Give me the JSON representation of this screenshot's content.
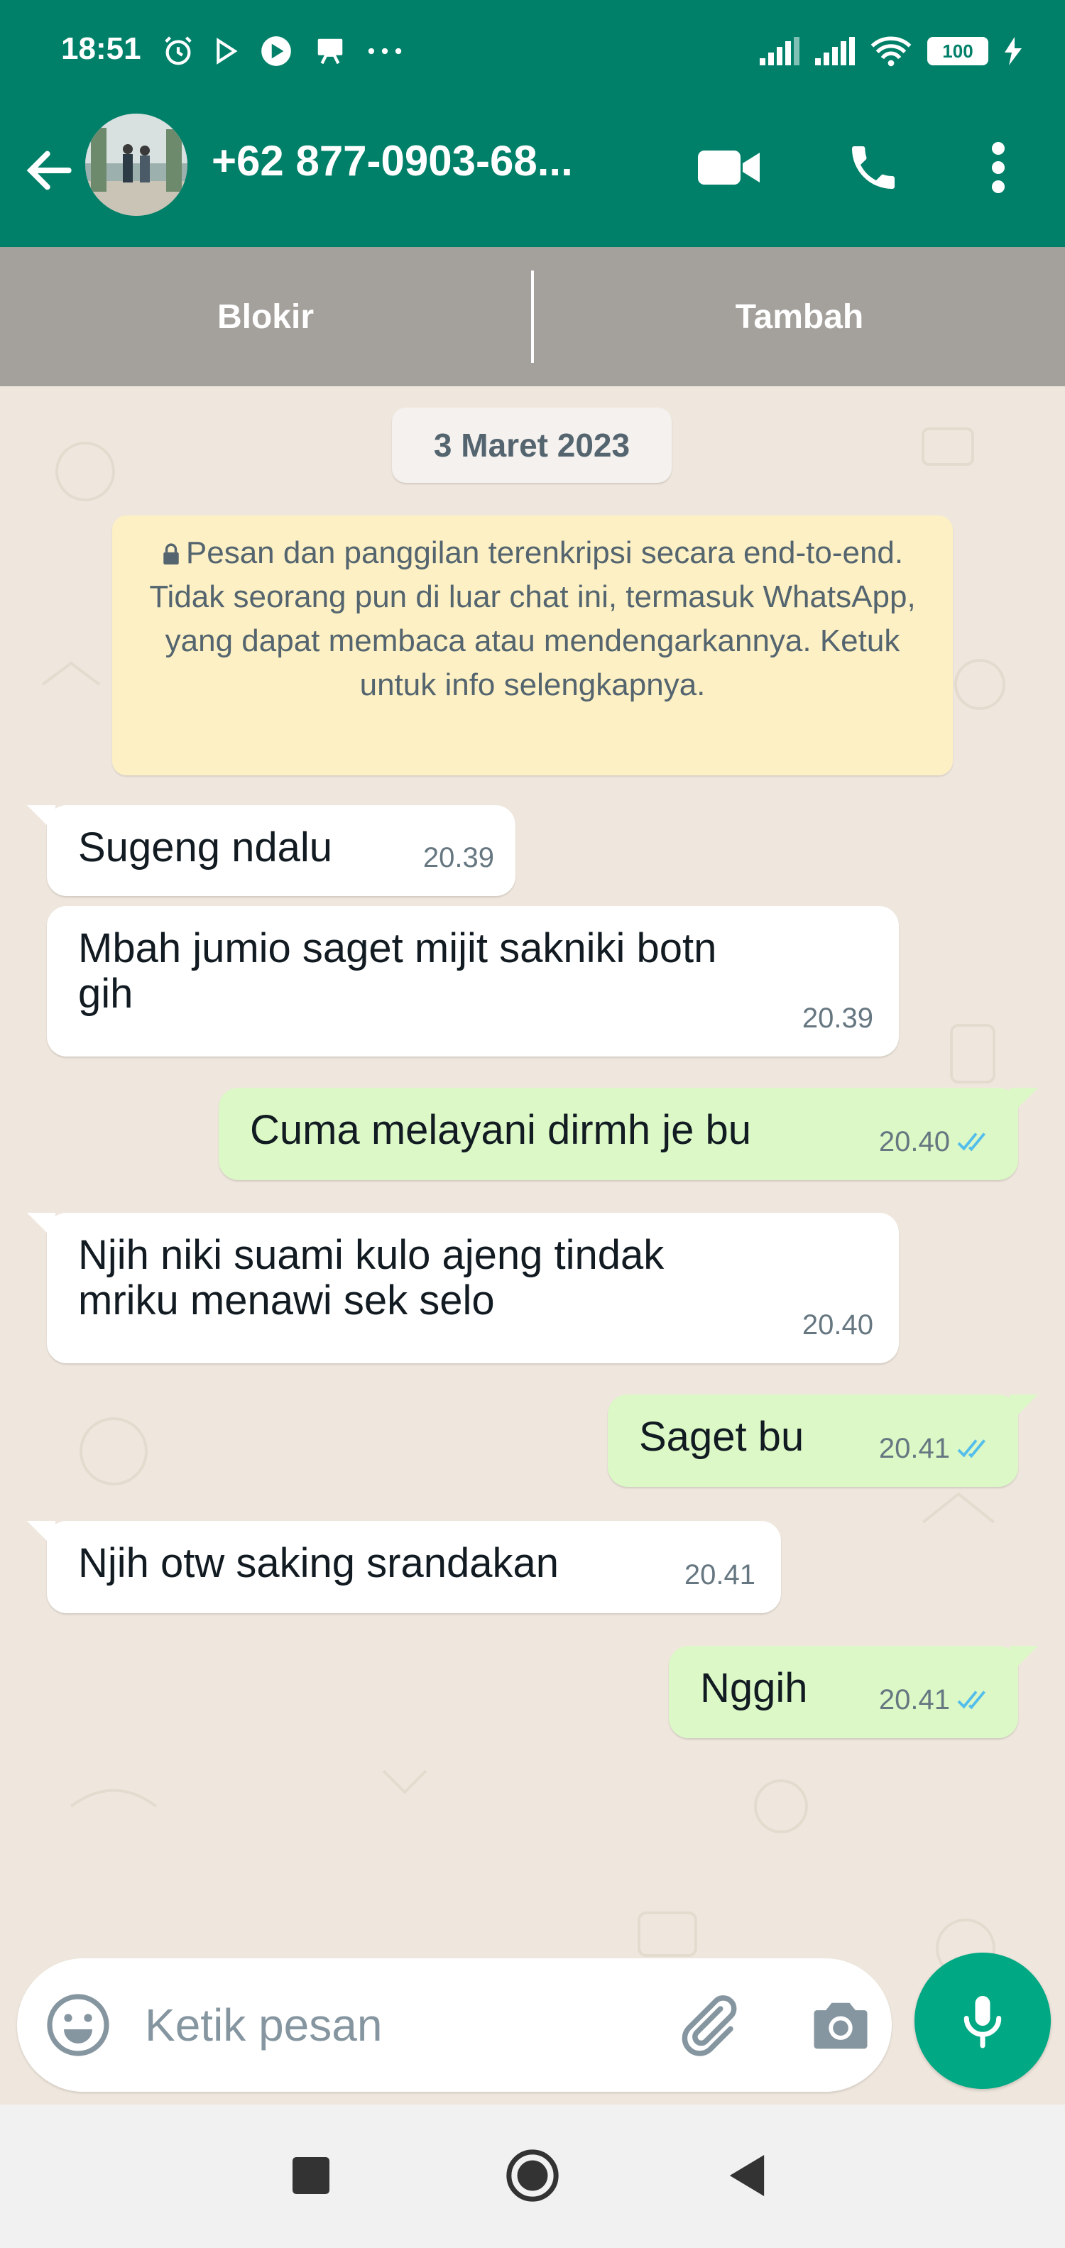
{
  "status_bar": {
    "time": "18:51",
    "notification_icons": [
      "alarm-icon",
      "play-icon",
      "media-icon",
      "desktop-icon",
      "more-dots-icon"
    ],
    "battery_level": "100",
    "status_icons": [
      "signal-icon",
      "signal-icon",
      "wifi-icon",
      "battery-icon",
      "charging-icon"
    ]
  },
  "header": {
    "contact_name": "+62 877-0903-68...",
    "actions": [
      "video-call-icon",
      "phone-icon",
      "more-vert-icon"
    ]
  },
  "action_bar": {
    "block_label": "Blokir",
    "add_label": "Tambah"
  },
  "chat": {
    "date_chip": "3 Maret 2023",
    "encryption_notice": "Pesan dan panggilan terenkripsi secara end-to-end. Tidak seorang pun di luar chat ini, termasuk WhatsApp, yang dapat membaca atau mendengarkannya. Ketuk untuk info selengkapnya.",
    "messages": [
      {
        "direction": "in",
        "lines": [
          "Sugeng ndalu"
        ],
        "time": "20.39"
      },
      {
        "direction": "in",
        "lines": [
          "Mbah jumio saget mijit sakniki botn",
          "gih"
        ],
        "time": "20.39"
      },
      {
        "direction": "out",
        "lines": [
          "Cuma melayani dirmh je bu"
        ],
        "time": "20.40",
        "status": "read"
      },
      {
        "direction": "in",
        "lines": [
          "Njih niki suami kulo ajeng tindak",
          "mriku menawi sek selo"
        ],
        "time": "20.40"
      },
      {
        "direction": "out",
        "lines": [
          "Saget bu"
        ],
        "time": "20.41",
        "status": "read"
      },
      {
        "direction": "in",
        "lines": [
          "Njih otw saking srandakan"
        ],
        "time": "20.41"
      },
      {
        "direction": "out",
        "lines": [
          "Nggih"
        ],
        "time": "20.41",
        "status": "read"
      }
    ]
  },
  "composer": {
    "placeholder": "Ketik pesan"
  },
  "colors": {
    "header": "#008069",
    "incoming_bubble": "#ffffff",
    "outgoing_bubble": "#dcf8c6",
    "read_ticks": "#53bdeb",
    "mic_button": "#00a884",
    "notice_bg": "#fdf0c4"
  }
}
